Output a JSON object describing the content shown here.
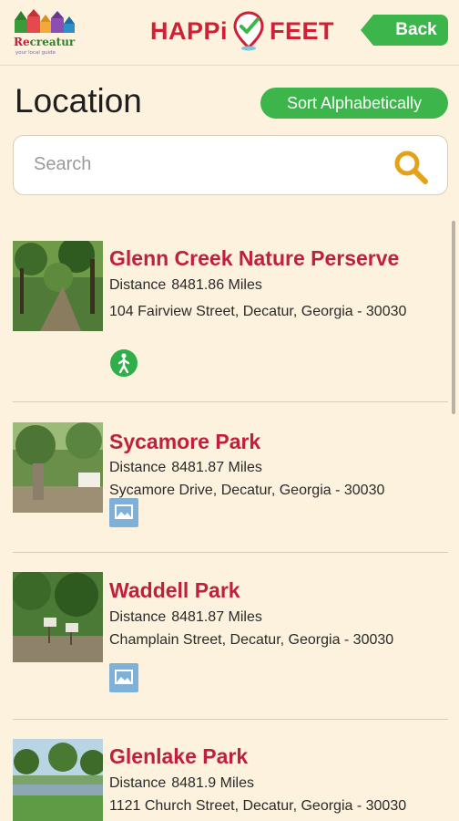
{
  "header": {
    "logo_text": "Recreatur",
    "logo_tagline": "your local guide",
    "brand_left": "HAPPi",
    "brand_right": "FEET",
    "back_label": "Back"
  },
  "page": {
    "title": "Location",
    "sort_label": "Sort Alphabetically"
  },
  "search": {
    "placeholder": "Search",
    "icon": "search-icon"
  },
  "locations": [
    {
      "name": "Glenn Creek Nature Perserve",
      "distance_label": "Distance",
      "distance": "8481.86 Miles",
      "address": "104 Fairview Street, Decatur, Georgia - 30030",
      "badge": "walking-person-icon"
    },
    {
      "name": "Sycamore Park",
      "distance_label": "Distance",
      "distance": "8481.87 Miles",
      "address": "Sycamore Drive, Decatur, Georgia - 30030",
      "badge": "image-icon"
    },
    {
      "name": "Waddell Park",
      "distance_label": "Distance",
      "distance": "8481.87 Miles",
      "address": "Champlain Street, Decatur, Georgia - 30030",
      "badge": "image-icon"
    },
    {
      "name": "Glenlake Park",
      "distance_label": "Distance",
      "distance": "8481.9 Miles",
      "address": "1121 Church Street, Decatur, Georgia - 30030",
      "badge": ""
    }
  ],
  "colors": {
    "background": "#fdf2dd",
    "accent_green": "#3cb54a",
    "title_red": "#c0203b",
    "brand_red": "#d11f35"
  }
}
